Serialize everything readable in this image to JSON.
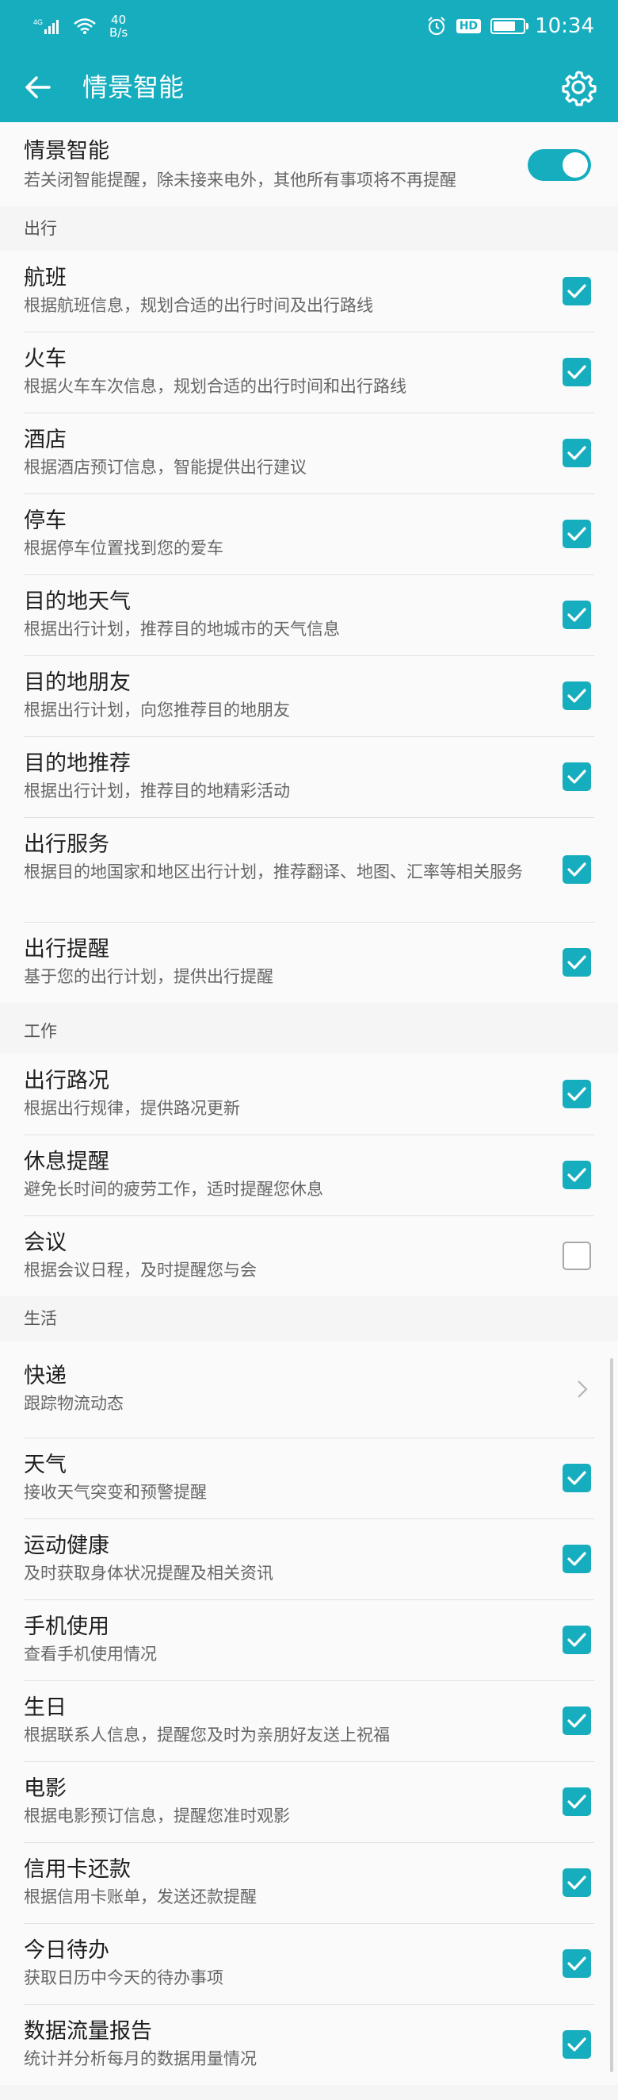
{
  "status_bar": {
    "signal": "4G",
    "net_speed_value": "40",
    "net_speed_unit": "B/s",
    "hd_badge": "HD",
    "battery_level": 0.75,
    "time": "10:34"
  },
  "app_bar": {
    "title": "情景智能",
    "back_icon": "arrow-left",
    "settings_icon": "gear"
  },
  "master": {
    "title": "情景智能",
    "desc": "若关闭智能提醒，除未接来电外，其他所有事项将不再提醒",
    "enabled": true
  },
  "sections": [
    {
      "header": "出行",
      "items": [
        {
          "title": "航班",
          "desc": "根据航班信息，规划合适的出行时间及出行路线",
          "checked": true
        },
        {
          "title": "火车",
          "desc": "根据火车车次信息，规划合适的出行时间和出行路线",
          "checked": true
        },
        {
          "title": "酒店",
          "desc": "根据酒店预订信息，智能提供出行建议",
          "checked": true
        },
        {
          "title": "停车",
          "desc": "根据停车位置找到您的爱车",
          "checked": true
        },
        {
          "title": "目的地天气",
          "desc": "根据出行计划，推荐目的地城市的天气信息",
          "checked": true
        },
        {
          "title": "目的地朋友",
          "desc": "根据出行计划，向您推荐目的地朋友",
          "checked": true
        },
        {
          "title": "目的地推荐",
          "desc": "根据出行计划，推荐目的地精彩活动",
          "checked": true
        },
        {
          "title": "出行服务",
          "desc": "根据目的地国家和地区出行计划，推荐翻译、地图、汇率等相关服务",
          "checked": true
        },
        {
          "title": "出行提醒",
          "desc": "基于您的出行计划，提供出行提醒",
          "checked": true
        }
      ]
    },
    {
      "header": "工作",
      "items": [
        {
          "title": "出行路况",
          "desc": "根据出行规律，提供路况更新",
          "checked": true
        },
        {
          "title": "休息提醒",
          "desc": "避免长时间的疲劳工作，适时提醒您休息",
          "checked": true
        },
        {
          "title": "会议",
          "desc": "根据会议日程，及时提醒您与会",
          "checked": false
        }
      ]
    },
    {
      "header": "生活",
      "items": [
        {
          "title": "快递",
          "desc": "跟踪物流动态",
          "type": "link"
        },
        {
          "title": "天气",
          "desc": "接收天气突变和预警提醒",
          "checked": true
        },
        {
          "title": "运动健康",
          "desc": "及时获取身体状况提醒及相关资讯",
          "checked": true
        },
        {
          "title": "手机使用",
          "desc": "查看手机使用情况",
          "checked": true
        },
        {
          "title": "生日",
          "desc": "根据联系人信息，提醒您及时为亲朋好友送上祝福",
          "checked": true
        },
        {
          "title": "电影",
          "desc": "根据电影预订信息，提醒您准时观影",
          "checked": true
        },
        {
          "title": "信用卡还款",
          "desc": "根据信用卡账单，发送还款提醒",
          "checked": true
        },
        {
          "title": "今日待办",
          "desc": "获取日历中今天的待办事项",
          "checked": true
        },
        {
          "title": "数据流量报告",
          "desc": "统计并分析每月的数据用量情况",
          "checked": true
        }
      ]
    }
  ],
  "colors": {
    "accent": "#16aebf",
    "unchecked_border": "#a8a8a8"
  }
}
